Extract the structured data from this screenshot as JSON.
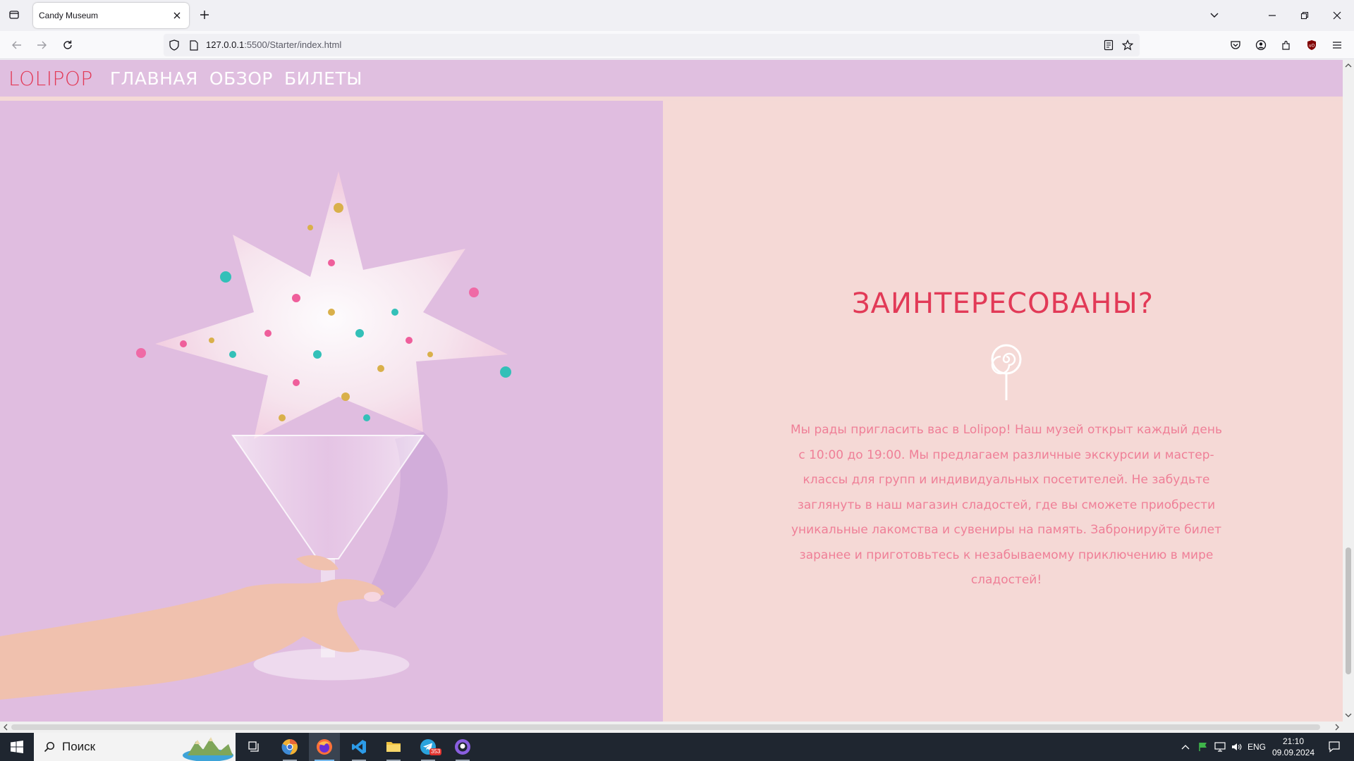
{
  "browser": {
    "tab_title": "Candy Museum",
    "url_host": "127.0.0.1",
    "url_rest": ":5500/Starter/index.html"
  },
  "site": {
    "logo": "LOLIPOP",
    "menu": [
      "ГЛАВНАЯ",
      "ОБЗОР",
      "БИЛЕТЫ"
    ],
    "cta_title": "ЗАИНТЕРЕСОВАНЫ?",
    "cta_text": "Мы рады пригласить вас в Lolipop! Наш музей открыт каждый день с 10:00 до 19:00. Мы предлагаем различные экскурсии и мастер-классы для групп и индивидуальных посетителей. Не забудьте заглянуть в наш магазин сладостей, где вы сможете приобрести уникальные лакомства и сувениры на память. Забронируйте билет заранее и приготовьтесь к незабываемому приключению в мире сладостей!",
    "colors": {
      "accent": "#e23a57",
      "header_bg": "#e0bfe0",
      "right_bg": "#f5d9d6",
      "text": "#ef7f97"
    }
  },
  "taskbar": {
    "search_placeholder": "Поиск",
    "telegram_badge": "353",
    "lang": "ENG",
    "time": "21:10",
    "date": "09.09.2024"
  }
}
